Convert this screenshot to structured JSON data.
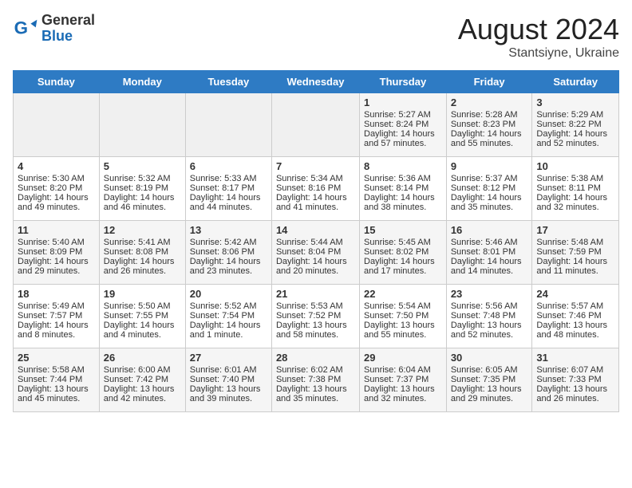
{
  "header": {
    "logo_general": "General",
    "logo_blue": "Blue",
    "month_year": "August 2024",
    "location": "Stantsiyne, Ukraine"
  },
  "weekdays": [
    "Sunday",
    "Monday",
    "Tuesday",
    "Wednesday",
    "Thursday",
    "Friday",
    "Saturday"
  ],
  "weeks": [
    [
      {
        "day": "",
        "sunrise": "",
        "sunset": "",
        "daylight": ""
      },
      {
        "day": "",
        "sunrise": "",
        "sunset": "",
        "daylight": ""
      },
      {
        "day": "",
        "sunrise": "",
        "sunset": "",
        "daylight": ""
      },
      {
        "day": "",
        "sunrise": "",
        "sunset": "",
        "daylight": ""
      },
      {
        "day": "1",
        "sunrise": "Sunrise: 5:27 AM",
        "sunset": "Sunset: 8:24 PM",
        "daylight": "Daylight: 14 hours and 57 minutes."
      },
      {
        "day": "2",
        "sunrise": "Sunrise: 5:28 AM",
        "sunset": "Sunset: 8:23 PM",
        "daylight": "Daylight: 14 hours and 55 minutes."
      },
      {
        "day": "3",
        "sunrise": "Sunrise: 5:29 AM",
        "sunset": "Sunset: 8:22 PM",
        "daylight": "Daylight: 14 hours and 52 minutes."
      }
    ],
    [
      {
        "day": "4",
        "sunrise": "Sunrise: 5:30 AM",
        "sunset": "Sunset: 8:20 PM",
        "daylight": "Daylight: 14 hours and 49 minutes."
      },
      {
        "day": "5",
        "sunrise": "Sunrise: 5:32 AM",
        "sunset": "Sunset: 8:19 PM",
        "daylight": "Daylight: 14 hours and 46 minutes."
      },
      {
        "day": "6",
        "sunrise": "Sunrise: 5:33 AM",
        "sunset": "Sunset: 8:17 PM",
        "daylight": "Daylight: 14 hours and 44 minutes."
      },
      {
        "day": "7",
        "sunrise": "Sunrise: 5:34 AM",
        "sunset": "Sunset: 8:16 PM",
        "daylight": "Daylight: 14 hours and 41 minutes."
      },
      {
        "day": "8",
        "sunrise": "Sunrise: 5:36 AM",
        "sunset": "Sunset: 8:14 PM",
        "daylight": "Daylight: 14 hours and 38 minutes."
      },
      {
        "day": "9",
        "sunrise": "Sunrise: 5:37 AM",
        "sunset": "Sunset: 8:12 PM",
        "daylight": "Daylight: 14 hours and 35 minutes."
      },
      {
        "day": "10",
        "sunrise": "Sunrise: 5:38 AM",
        "sunset": "Sunset: 8:11 PM",
        "daylight": "Daylight: 14 hours and 32 minutes."
      }
    ],
    [
      {
        "day": "11",
        "sunrise": "Sunrise: 5:40 AM",
        "sunset": "Sunset: 8:09 PM",
        "daylight": "Daylight: 14 hours and 29 minutes."
      },
      {
        "day": "12",
        "sunrise": "Sunrise: 5:41 AM",
        "sunset": "Sunset: 8:08 PM",
        "daylight": "Daylight: 14 hours and 26 minutes."
      },
      {
        "day": "13",
        "sunrise": "Sunrise: 5:42 AM",
        "sunset": "Sunset: 8:06 PM",
        "daylight": "Daylight: 14 hours and 23 minutes."
      },
      {
        "day": "14",
        "sunrise": "Sunrise: 5:44 AM",
        "sunset": "Sunset: 8:04 PM",
        "daylight": "Daylight: 14 hours and 20 minutes."
      },
      {
        "day": "15",
        "sunrise": "Sunrise: 5:45 AM",
        "sunset": "Sunset: 8:02 PM",
        "daylight": "Daylight: 14 hours and 17 minutes."
      },
      {
        "day": "16",
        "sunrise": "Sunrise: 5:46 AM",
        "sunset": "Sunset: 8:01 PM",
        "daylight": "Daylight: 14 hours and 14 minutes."
      },
      {
        "day": "17",
        "sunrise": "Sunrise: 5:48 AM",
        "sunset": "Sunset: 7:59 PM",
        "daylight": "Daylight: 14 hours and 11 minutes."
      }
    ],
    [
      {
        "day": "18",
        "sunrise": "Sunrise: 5:49 AM",
        "sunset": "Sunset: 7:57 PM",
        "daylight": "Daylight: 14 hours and 8 minutes."
      },
      {
        "day": "19",
        "sunrise": "Sunrise: 5:50 AM",
        "sunset": "Sunset: 7:55 PM",
        "daylight": "Daylight: 14 hours and 4 minutes."
      },
      {
        "day": "20",
        "sunrise": "Sunrise: 5:52 AM",
        "sunset": "Sunset: 7:54 PM",
        "daylight": "Daylight: 14 hours and 1 minute."
      },
      {
        "day": "21",
        "sunrise": "Sunrise: 5:53 AM",
        "sunset": "Sunset: 7:52 PM",
        "daylight": "Daylight: 13 hours and 58 minutes."
      },
      {
        "day": "22",
        "sunrise": "Sunrise: 5:54 AM",
        "sunset": "Sunset: 7:50 PM",
        "daylight": "Daylight: 13 hours and 55 minutes."
      },
      {
        "day": "23",
        "sunrise": "Sunrise: 5:56 AM",
        "sunset": "Sunset: 7:48 PM",
        "daylight": "Daylight: 13 hours and 52 minutes."
      },
      {
        "day": "24",
        "sunrise": "Sunrise: 5:57 AM",
        "sunset": "Sunset: 7:46 PM",
        "daylight": "Daylight: 13 hours and 48 minutes."
      }
    ],
    [
      {
        "day": "25",
        "sunrise": "Sunrise: 5:58 AM",
        "sunset": "Sunset: 7:44 PM",
        "daylight": "Daylight: 13 hours and 45 minutes."
      },
      {
        "day": "26",
        "sunrise": "Sunrise: 6:00 AM",
        "sunset": "Sunset: 7:42 PM",
        "daylight": "Daylight: 13 hours and 42 minutes."
      },
      {
        "day": "27",
        "sunrise": "Sunrise: 6:01 AM",
        "sunset": "Sunset: 7:40 PM",
        "daylight": "Daylight: 13 hours and 39 minutes."
      },
      {
        "day": "28",
        "sunrise": "Sunrise: 6:02 AM",
        "sunset": "Sunset: 7:38 PM",
        "daylight": "Daylight: 13 hours and 35 minutes."
      },
      {
        "day": "29",
        "sunrise": "Sunrise: 6:04 AM",
        "sunset": "Sunset: 7:37 PM",
        "daylight": "Daylight: 13 hours and 32 minutes."
      },
      {
        "day": "30",
        "sunrise": "Sunrise: 6:05 AM",
        "sunset": "Sunset: 7:35 PM",
        "daylight": "Daylight: 13 hours and 29 minutes."
      },
      {
        "day": "31",
        "sunrise": "Sunrise: 6:07 AM",
        "sunset": "Sunset: 7:33 PM",
        "daylight": "Daylight: 13 hours and 26 minutes."
      }
    ]
  ]
}
